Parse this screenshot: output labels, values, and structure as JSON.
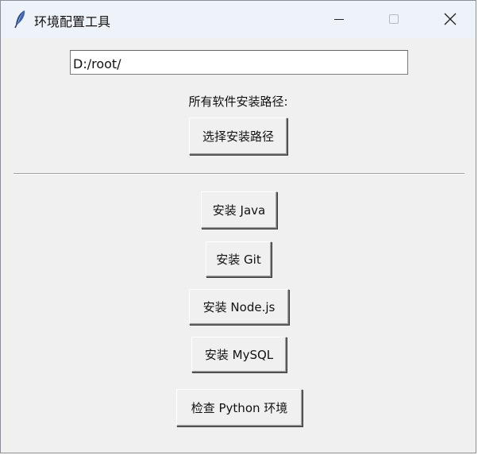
{
  "window": {
    "title": "环境配置工具",
    "controls": {
      "minimize_icon": "minimize-icon",
      "maximize_icon": "maximize-icon",
      "close_icon": "close-icon"
    }
  },
  "path": {
    "value": "D:/root/",
    "label": "所有软件安装路径:",
    "choose_button": "选择安装路径"
  },
  "actions": {
    "install_java": "安装 Java",
    "install_git": "安装 Git",
    "install_node": "安装 Node.js",
    "install_mysql": "安装 MySQL",
    "check_python": "检查 Python 环境"
  },
  "colors": {
    "window_bg": "#f0f0f0",
    "titlebar_bg": "#eef2f9",
    "icon_blue": "#2b4a8a"
  }
}
